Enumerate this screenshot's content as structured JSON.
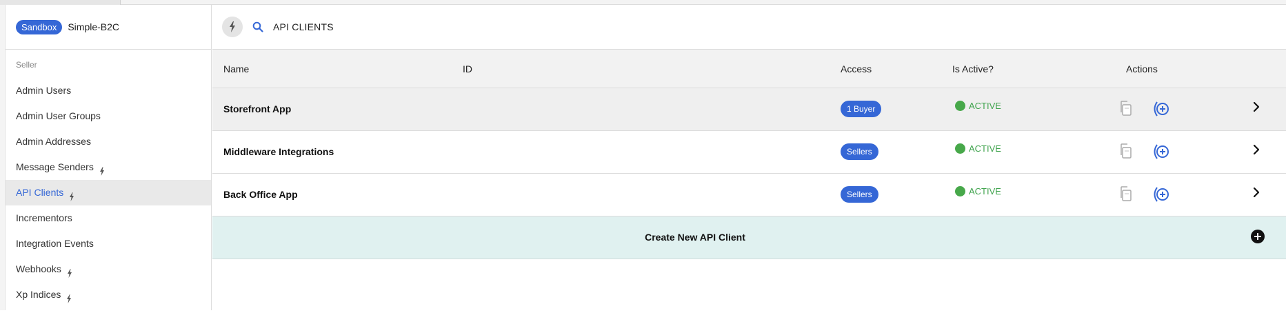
{
  "context": {
    "environment": "Sandbox",
    "marketplace": "Simple-B2C"
  },
  "sidebar": {
    "section": "Seller",
    "items": [
      {
        "label": "Admin Users",
        "bolt": false,
        "active": false
      },
      {
        "label": "Admin User Groups",
        "bolt": false,
        "active": false
      },
      {
        "label": "Admin Addresses",
        "bolt": false,
        "active": false
      },
      {
        "label": "Message Senders",
        "bolt": true,
        "active": false
      },
      {
        "label": "API Clients",
        "bolt": true,
        "active": true
      },
      {
        "label": "Incrementors",
        "bolt": false,
        "active": false
      },
      {
        "label": "Integration Events",
        "bolt": false,
        "active": false
      },
      {
        "label": "Webhooks",
        "bolt": true,
        "active": false
      },
      {
        "label": "Xp Indices",
        "bolt": true,
        "active": false
      }
    ]
  },
  "header": {
    "title": "API CLIENTS",
    "icons": [
      "bolt-icon",
      "search-icon"
    ]
  },
  "table": {
    "columns": [
      "Name",
      "ID",
      "Access",
      "Is Active?",
      "Actions"
    ],
    "rows": [
      {
        "name": "Storefront App",
        "id": "",
        "access": "1 Buyer",
        "status": "ACTIVE"
      },
      {
        "name": "Middleware Integrations",
        "id": "",
        "access": "Sellers",
        "status": "ACTIVE"
      },
      {
        "name": "Back Office App",
        "id": "",
        "access": "Sellers",
        "status": "ACTIVE"
      }
    ],
    "create_label": "Create New API Client"
  },
  "colors": {
    "accent": "#3567d6",
    "active_green": "#47a84a",
    "create_bg": "#e0f1f0"
  }
}
